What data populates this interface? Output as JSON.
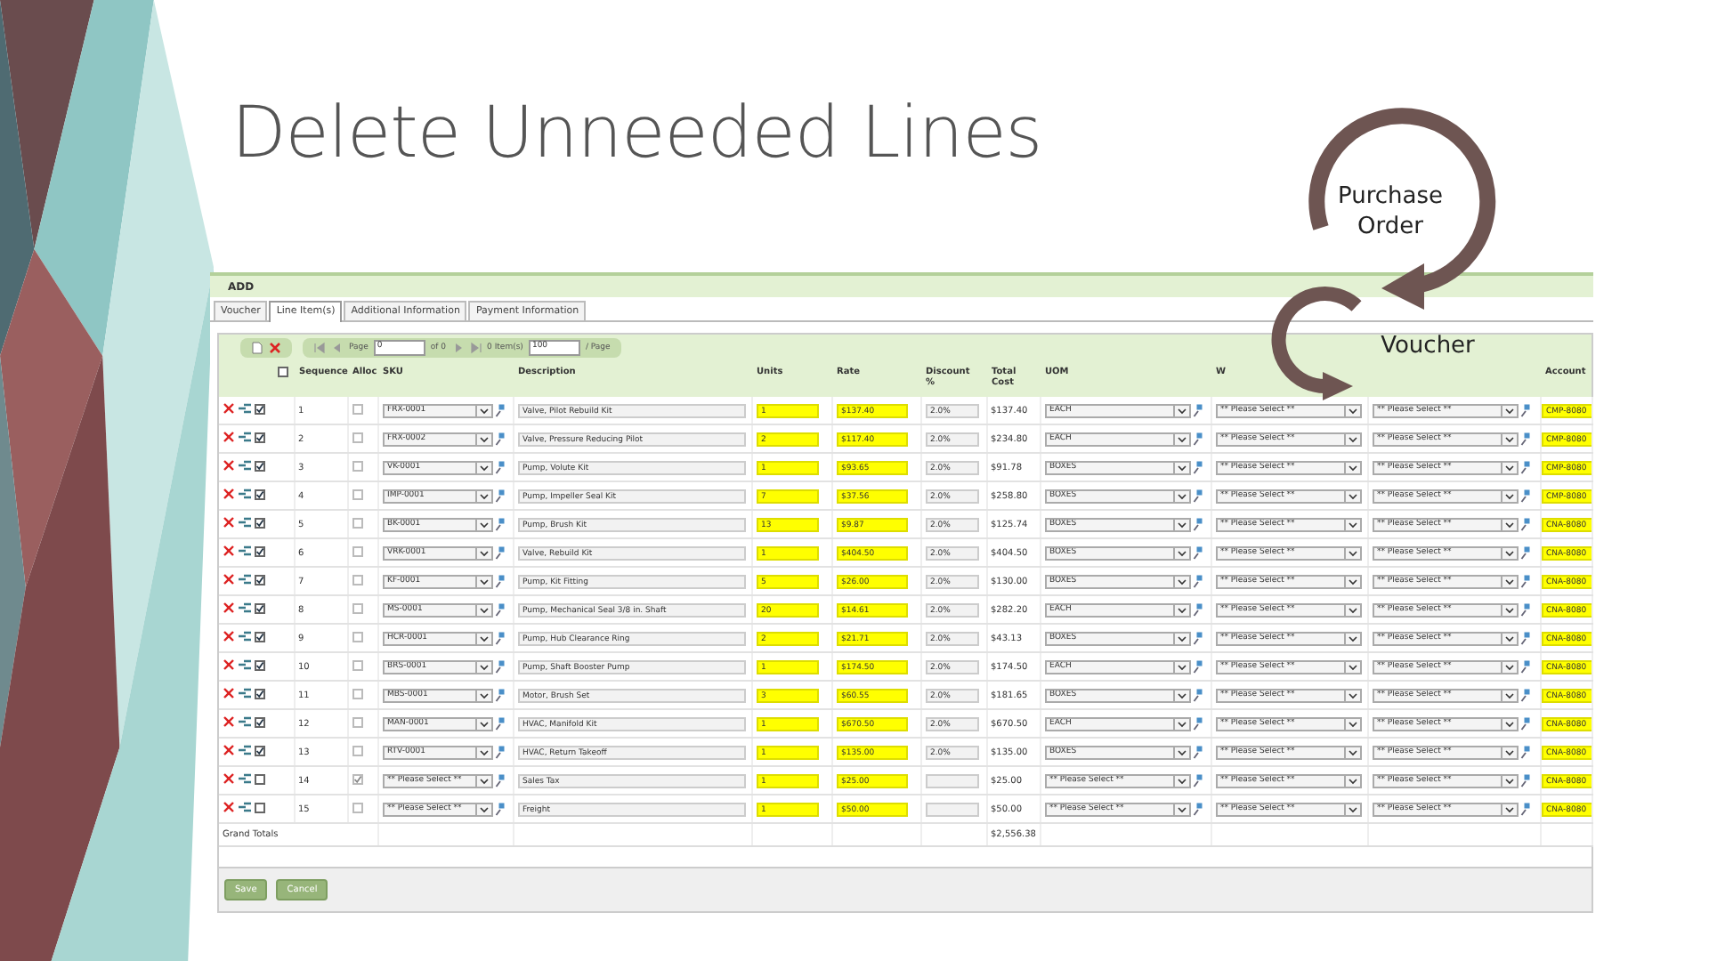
{
  "slide": {
    "title": "Delete Unneeded Lines",
    "cycle_labels": [
      "Purchase Order",
      "Voucher"
    ]
  },
  "form": {
    "header": "ADD",
    "tabs": [
      {
        "label": "Voucher",
        "selected": false
      },
      {
        "label": "Line Item(s)",
        "selected": true
      },
      {
        "label": "Additional Information",
        "selected": false
      },
      {
        "label": "Payment Information",
        "selected": false
      }
    ],
    "toolbar": {
      "page_label": "Page",
      "page": "0",
      "of_pages": "of 0",
      "items": "0 Item(s)",
      "page_size": "100",
      "page_size_suffix": "/ Page"
    },
    "select_all": {
      "checked": false
    },
    "columns": [
      "Sequence",
      "Alloc",
      "SKU",
      "Description",
      "Units",
      "Rate",
      "Discount %",
      "Total Cost",
      "UOM",
      "W",
      "Account"
    ],
    "rows": [
      {
        "selected": true,
        "alloc": false,
        "sequence": "1",
        "sku": "FRX-0001",
        "description": "Valve, Pilot Rebuild Kit",
        "units": "1",
        "rate": "$137.40",
        "discount": "2.0%",
        "total": "$137.40",
        "uom": "EACH",
        "warehouse": "** Please Select **",
        "bin": "** Please Select **",
        "account": "CMP-8080"
      },
      {
        "selected": true,
        "alloc": false,
        "sequence": "2",
        "sku": "FRX-0002",
        "description": "Valve, Pressure Reducing Pilot",
        "units": "2",
        "rate": "$117.40",
        "discount": "2.0%",
        "total": "$234.80",
        "uom": "EACH",
        "warehouse": "** Please Select **",
        "bin": "** Please Select **",
        "account": "CMP-8080"
      },
      {
        "selected": true,
        "alloc": false,
        "sequence": "3",
        "sku": "VK-0001",
        "description": "Pump, Volute Kit",
        "units": "1",
        "rate": "$93.65",
        "discount": "2.0%",
        "total": "$91.78",
        "uom": "BOXES",
        "warehouse": "** Please Select **",
        "bin": "** Please Select **",
        "account": "CMP-8080"
      },
      {
        "selected": true,
        "alloc": false,
        "sequence": "4",
        "sku": "IMP-0001",
        "description": "Pump, Impeller Seal Kit",
        "units": "7",
        "rate": "$37.56",
        "discount": "2.0%",
        "total": "$258.80",
        "uom": "BOXES",
        "warehouse": "** Please Select **",
        "bin": "** Please Select **",
        "account": "CMP-8080"
      },
      {
        "selected": true,
        "alloc": false,
        "sequence": "5",
        "sku": "BK-0001",
        "description": "Pump, Brush Kit",
        "units": "13",
        "rate": "$9.87",
        "discount": "2.0%",
        "total": "$125.74",
        "uom": "BOXES",
        "warehouse": "** Please Select **",
        "bin": "** Please Select **",
        "account": "CNA-8080"
      },
      {
        "selected": true,
        "alloc": false,
        "sequence": "6",
        "sku": "VRK-0001",
        "description": "Valve, Rebuild Kit",
        "units": "1",
        "rate": "$404.50",
        "discount": "2.0%",
        "total": "$404.50",
        "uom": "BOXES",
        "warehouse": "** Please Select **",
        "bin": "** Please Select **",
        "account": "CNA-8080"
      },
      {
        "selected": true,
        "alloc": false,
        "sequence": "7",
        "sku": "KF-0001",
        "description": "Pump, Kit Fitting",
        "units": "5",
        "rate": "$26.00",
        "discount": "2.0%",
        "total": "$130.00",
        "uom": "BOXES",
        "warehouse": "** Please Select **",
        "bin": "** Please Select **",
        "account": "CNA-8080"
      },
      {
        "selected": true,
        "alloc": false,
        "sequence": "8",
        "sku": "MS-0001",
        "description": "Pump, Mechanical Seal 3/8 in. Shaft",
        "units": "20",
        "rate": "$14.61",
        "discount": "2.0%",
        "total": "$282.20",
        "uom": "EACH",
        "warehouse": "** Please Select **",
        "bin": "** Please Select **",
        "account": "CNA-8080"
      },
      {
        "selected": true,
        "alloc": false,
        "sequence": "9",
        "sku": "HCR-0001",
        "description": "Pump, Hub Clearance Ring",
        "units": "2",
        "rate": "$21.71",
        "discount": "2.0%",
        "total": "$43.13",
        "uom": "BOXES",
        "warehouse": "** Please Select **",
        "bin": "** Please Select **",
        "account": "CNA-8080"
      },
      {
        "selected": true,
        "alloc": false,
        "sequence": "10",
        "sku": "BRS-0001",
        "description": "Pump, Shaft Booster Pump",
        "units": "1",
        "rate": "$174.50",
        "discount": "2.0%",
        "total": "$174.50",
        "uom": "EACH",
        "warehouse": "** Please Select **",
        "bin": "** Please Select **",
        "account": "CNA-8080"
      },
      {
        "selected": true,
        "alloc": false,
        "sequence": "11",
        "sku": "MBS-0001",
        "description": "Motor, Brush Set",
        "units": "3",
        "rate": "$60.55",
        "discount": "2.0%",
        "total": "$181.65",
        "uom": "BOXES",
        "warehouse": "** Please Select **",
        "bin": "** Please Select **",
        "account": "CNA-8080"
      },
      {
        "selected": true,
        "alloc": false,
        "sequence": "12",
        "sku": "MAN-0001",
        "description": "HVAC, Manifold Kit",
        "units": "1",
        "rate": "$670.50",
        "discount": "2.0%",
        "total": "$670.50",
        "uom": "EACH",
        "warehouse": "** Please Select **",
        "bin": "** Please Select **",
        "account": "CNA-8080"
      },
      {
        "selected": true,
        "alloc": false,
        "sequence": "13",
        "sku": "RTV-0001",
        "description": "HVAC, Return Takeoff",
        "units": "1",
        "rate": "$135.00",
        "discount": "2.0%",
        "total": "$135.00",
        "uom": "BOXES",
        "warehouse": "** Please Select **",
        "bin": "** Please Select **",
        "account": "CNA-8080"
      },
      {
        "selected": false,
        "alloc": true,
        "sequence": "14",
        "sku": "** Please Select **",
        "description": "Sales Tax",
        "units": "1",
        "rate": "$25.00",
        "total": "$25.00",
        "uom": "** Please Select **",
        "warehouse": "** Please Select **",
        "bin": "** Please Select **",
        "account": "CNA-8080"
      },
      {
        "selected": false,
        "alloc": false,
        "sequence": "15",
        "sku": "** Please Select **",
        "description": "Freight",
        "units": "1",
        "rate": "$50.00",
        "total": "$50.00",
        "uom": "** Please Select **",
        "warehouse": "** Please Select **",
        "bin": "** Please Select **",
        "account": "CNA-8080"
      }
    ],
    "totals": {
      "label": "Grand Totals",
      "total": "$2,556.38"
    },
    "buttons": [
      "Save",
      "Cancel"
    ]
  }
}
